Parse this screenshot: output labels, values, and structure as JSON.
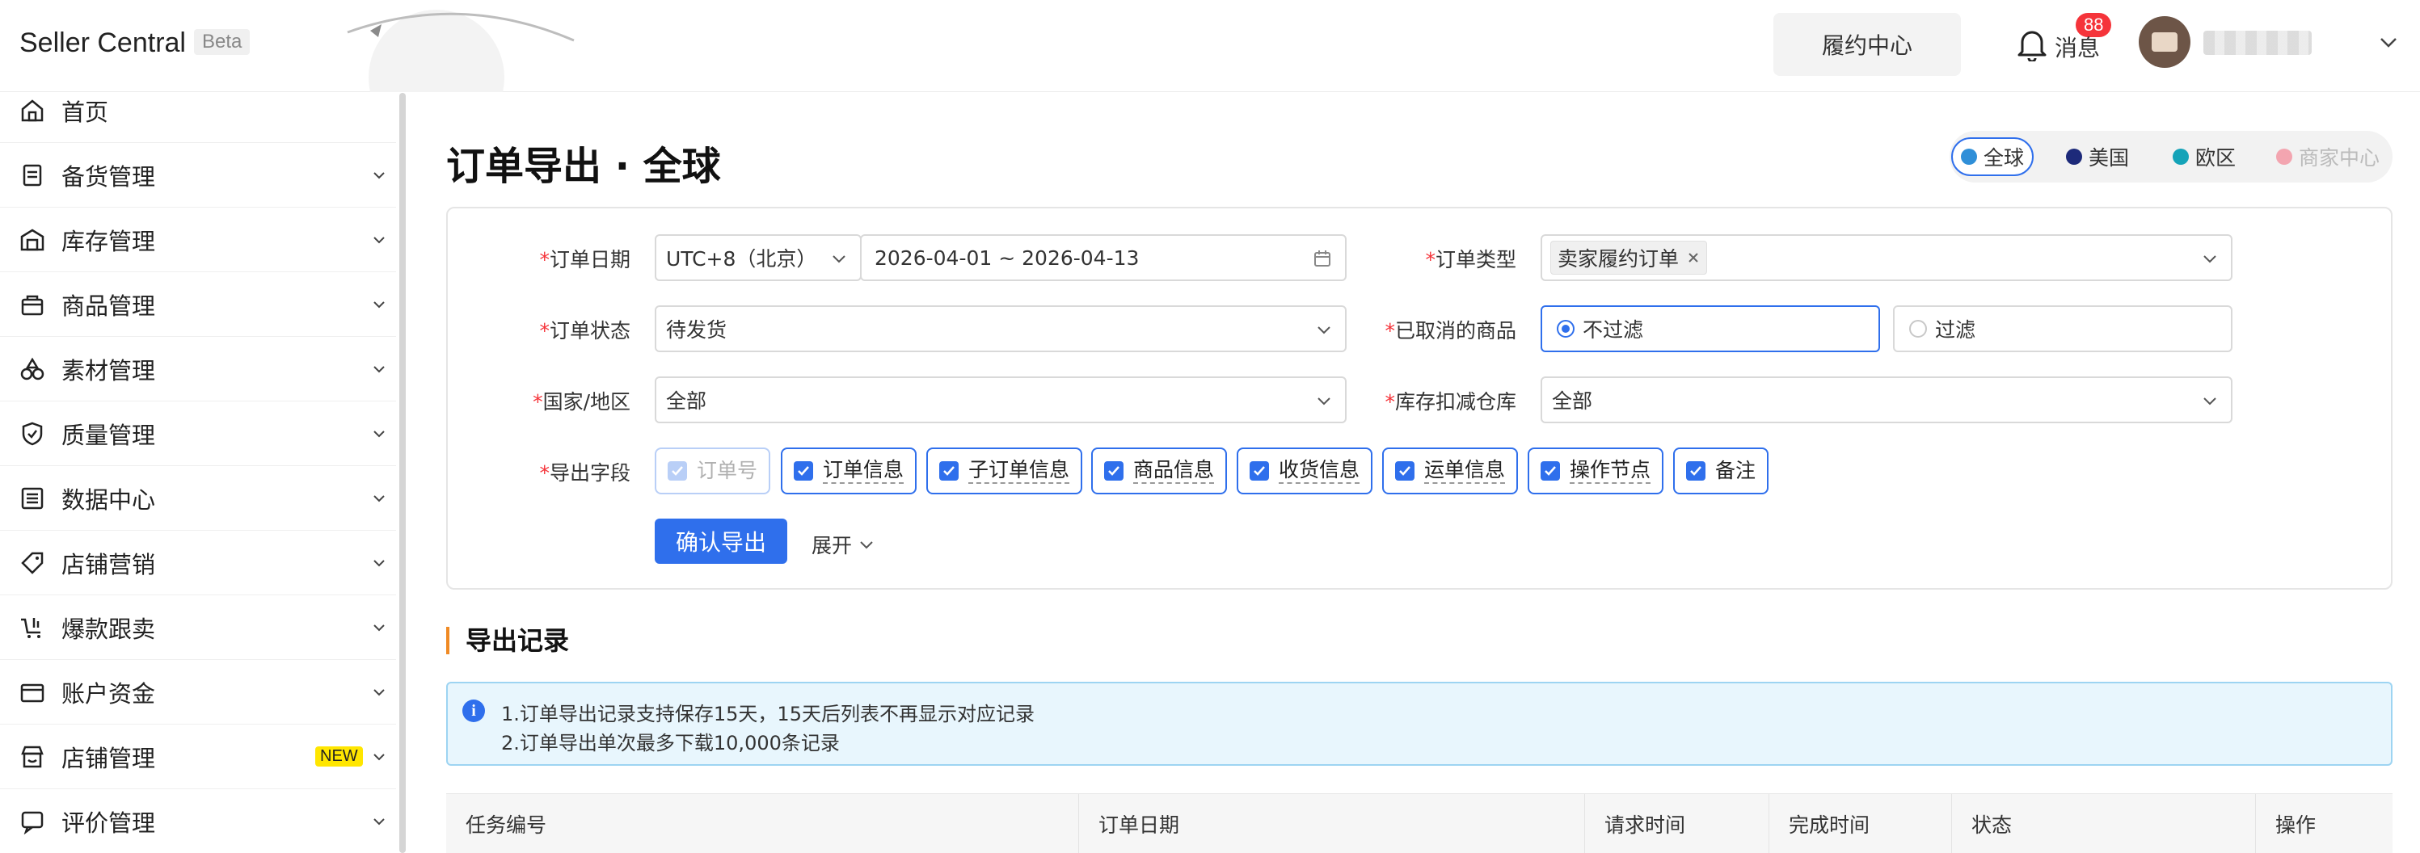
{
  "header": {
    "brand": "Seller Central",
    "beta": "Beta",
    "fulfillment_button": "履约中心",
    "messages_label": "消息",
    "messages_count": "88"
  },
  "sidebar": {
    "items": [
      {
        "label": "首页",
        "icon": "home-icon",
        "has_chevron": false
      },
      {
        "label": "备货管理",
        "icon": "clipboard-icon",
        "has_chevron": true
      },
      {
        "label": "库存管理",
        "icon": "warehouse-icon",
        "has_chevron": true
      },
      {
        "label": "商品管理",
        "icon": "box-icon",
        "has_chevron": true
      },
      {
        "label": "素材管理",
        "icon": "shapes-icon",
        "has_chevron": true
      },
      {
        "label": "质量管理",
        "icon": "shield-icon",
        "has_chevron": true
      },
      {
        "label": "数据中心",
        "icon": "data-icon",
        "has_chevron": true
      },
      {
        "label": "店铺营销",
        "icon": "tag-icon",
        "has_chevron": true
      },
      {
        "label": "爆款跟卖",
        "icon": "cart-icon",
        "has_chevron": true
      },
      {
        "label": "账户资金",
        "icon": "wallet-icon",
        "has_chevron": true
      },
      {
        "label": "店铺管理",
        "icon": "store-icon",
        "has_chevron": true,
        "badge": "NEW"
      },
      {
        "label": "评价管理",
        "icon": "comment-icon",
        "has_chevron": true
      }
    ]
  },
  "page": {
    "title": "订单导出 · 全球",
    "regions": [
      {
        "label": "全球",
        "active": true,
        "color": "#2f8fd8"
      },
      {
        "label": "美国",
        "active": false,
        "color": "#1d2a7a"
      },
      {
        "label": "欧区",
        "active": false,
        "color": "#14a3b8"
      },
      {
        "label": "商家中心",
        "active": false,
        "color": "#f3a5b0",
        "muted": true
      }
    ]
  },
  "form": {
    "order_date": {
      "label": "订单日期",
      "timezone": "UTC+8（北京）",
      "range": "2026-04-01 ~ 2026-04-13"
    },
    "order_type": {
      "label": "订单类型",
      "tag": "卖家履约订单"
    },
    "order_status": {
      "label": "订单状态",
      "value": "待发货"
    },
    "cancelled_goods": {
      "label": "已取消的商品",
      "options": [
        "不过滤",
        "过滤"
      ],
      "selected": "不过滤"
    },
    "country": {
      "label": "国家/地区",
      "value": "全部"
    },
    "warehouse": {
      "label": "库存扣减仓库",
      "value": "全部"
    },
    "export_fields": {
      "label": "导出字段",
      "options": [
        "订单号",
        "订单信息",
        "子订单信息",
        "商品信息",
        "收货信息",
        "运单信息",
        "操作节点",
        "备注"
      ]
    },
    "confirm_button": "确认导出",
    "expand_label": "展开"
  },
  "records": {
    "title": "导出记录",
    "notice_line1": "1.订单导出记录支持保存15天，15天后列表不再显示对应记录",
    "notice_line2": "2.订单导出单次最多下载10,000条记录",
    "columns": [
      "任务编号",
      "订单日期",
      "请求时间",
      "完成时间",
      "状态",
      "操作"
    ]
  },
  "colors": {
    "primary": "#2f6fec",
    "danger": "#f5343a",
    "accent": "#f08a24"
  }
}
